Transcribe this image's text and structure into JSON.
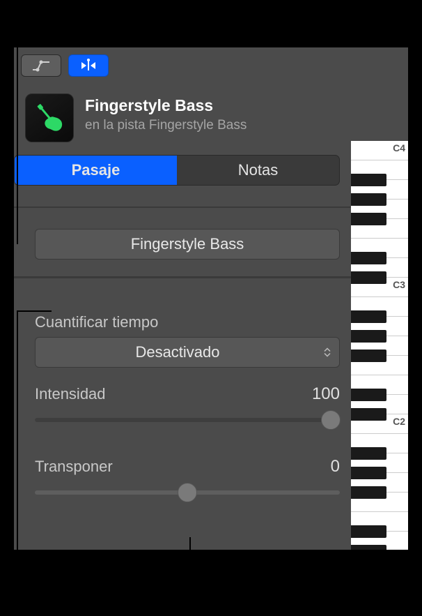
{
  "toolbar": {
    "automation_mode_active": false,
    "flex_mode_active": true
  },
  "instrument": {
    "title": "Fingerstyle Bass",
    "subtitle": "en la pista Fingerstyle Bass",
    "icon": "bass-guitar-icon",
    "icon_color": "#2dd966"
  },
  "tabs": {
    "region_label": "Pasaje",
    "notes_label": "Notas",
    "selected": "region"
  },
  "region": {
    "name": "Fingerstyle Bass"
  },
  "quantize": {
    "label": "Cuantificar tiempo",
    "value": "Desactivado"
  },
  "intensity": {
    "label": "Intensidad",
    "value": "100",
    "percent": 100
  },
  "transpose": {
    "label": "Transponer",
    "value": "0",
    "percent": 50
  },
  "piano": {
    "labels": [
      "C4",
      "C3",
      "C2"
    ]
  }
}
